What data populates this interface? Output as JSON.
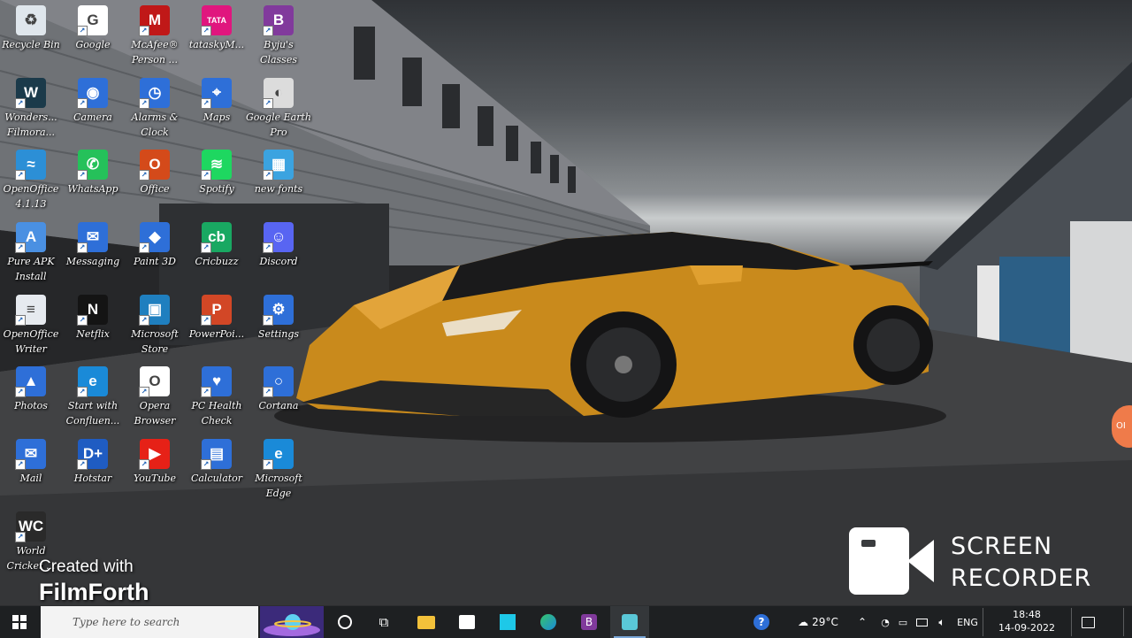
{
  "desktop": {
    "icons": [
      {
        "label": "Recycle Bin",
        "icon": "recycle-bin-icon",
        "color": "#dfe6ec",
        "glyph": "♻"
      },
      {
        "label": "Google",
        "icon": "google-icon",
        "color": "#ffffff",
        "glyph": "G"
      },
      {
        "label": "McAfee® Person ...",
        "icon": "mcafee-icon",
        "color": "#c01818",
        "glyph": "M"
      },
      {
        "label": "tataskyM...",
        "icon": "tata-play-icon",
        "color": "#e0167e",
        "glyph": "TATA"
      },
      {
        "label": "Byju's Classes",
        "icon": "byjus-icon",
        "color": "#813a9c",
        "glyph": "B"
      },
      {
        "label": "Wonders... Filmora...",
        "icon": "filmora-icon",
        "color": "#1b3a4a",
        "glyph": "W"
      },
      {
        "label": "Camera",
        "icon": "camera-icon",
        "color": "#2e6fd8",
        "glyph": "◉"
      },
      {
        "label": "Alarms & Clock",
        "icon": "clock-icon",
        "color": "#2e6fd8",
        "glyph": "◷"
      },
      {
        "label": "Maps",
        "icon": "maps-icon",
        "color": "#2e6fd8",
        "glyph": "⌖"
      },
      {
        "label": "Google Earth Pro",
        "icon": "google-earth-icon",
        "color": "#dcdcdc",
        "glyph": "◐"
      },
      {
        "label": "OpenOffice 4.1.13",
        "icon": "openoffice-icon",
        "color": "#2c8fd6",
        "glyph": "≈"
      },
      {
        "label": "WhatsApp",
        "icon": "whatsapp-icon",
        "color": "#25c15a",
        "glyph": "✆"
      },
      {
        "label": "Office",
        "icon": "office-icon",
        "color": "#d44a1a",
        "glyph": "O"
      },
      {
        "label": "Spotify",
        "icon": "spotify-icon",
        "color": "#1ed760",
        "glyph": "≋"
      },
      {
        "label": "new fonts",
        "icon": "folder-zip-icon",
        "color": "#3ba3e0",
        "glyph": "▦"
      },
      {
        "label": "Pure APK Install",
        "icon": "pure-apk-icon",
        "color": "#4a90e2",
        "glyph": "A"
      },
      {
        "label": "Messaging",
        "icon": "messaging-icon",
        "color": "#2e6fd8",
        "glyph": "✉"
      },
      {
        "label": "Paint 3D",
        "icon": "paint-3d-icon",
        "color": "#2e6fd8",
        "glyph": "◆"
      },
      {
        "label": "Cricbuzz",
        "icon": "cricbuzz-icon",
        "color": "#19a862",
        "glyph": "cb"
      },
      {
        "label": "Discord",
        "icon": "discord-icon",
        "color": "#5865f2",
        "glyph": "☺"
      },
      {
        "label": "OpenOffice Writer",
        "icon": "writer-icon",
        "color": "#e6eaef",
        "glyph": "≡"
      },
      {
        "label": "Netflix",
        "icon": "netflix-icon",
        "color": "#141414",
        "glyph": "N"
      },
      {
        "label": "Microsoft Store",
        "icon": "store-icon",
        "color": "#1f7fbf",
        "glyph": "▣"
      },
      {
        "label": "PowerPoi...",
        "icon": "powerpoint-icon",
        "color": "#d24726",
        "glyph": "P"
      },
      {
        "label": "Settings",
        "icon": "settings-icon",
        "color": "#2e6fd8",
        "glyph": "⚙"
      },
      {
        "label": "Photos",
        "icon": "photos-icon",
        "color": "#2e6fd8",
        "glyph": "▲"
      },
      {
        "label": "Start with Confluen...",
        "icon": "edge-icon",
        "color": "#1a8ad8",
        "glyph": "e"
      },
      {
        "label": "Opera Browser",
        "icon": "opera-icon",
        "color": "#ffffff",
        "glyph": "O"
      },
      {
        "label": "PC Health Check",
        "icon": "health-check-icon",
        "color": "#2e6fd8",
        "glyph": "♥"
      },
      {
        "label": "Cortana",
        "icon": "cortana-icon",
        "color": "#2e6fd8",
        "glyph": "○"
      },
      {
        "label": "Mail",
        "icon": "mail-icon",
        "color": "#2e6fd8",
        "glyph": "✉"
      },
      {
        "label": "Hotstar",
        "icon": "hotstar-icon",
        "color": "#1f5cc2",
        "glyph": "D+"
      },
      {
        "label": "YouTube",
        "icon": "youtube-icon",
        "color": "#e62117",
        "glyph": "▶"
      },
      {
        "label": "Calculator",
        "icon": "calculator-icon",
        "color": "#2e6fd8",
        "glyph": "▤"
      },
      {
        "label": "Microsoft Edge",
        "icon": "edge-browser-icon",
        "color": "#1a8ad8",
        "glyph": "e"
      },
      {
        "label": "World Cricket ...",
        "icon": "world-cricket-icon",
        "color": "#2a2a2a",
        "glyph": "WC"
      }
    ]
  },
  "watermark": {
    "line1": "Created with",
    "line2": "FilmForth"
  },
  "recorder": {
    "line1": "SCREEN",
    "line2": "RECORDER"
  },
  "side_bubble": {
    "text": "OI"
  },
  "taskbar": {
    "search_placeholder": "Type here to search",
    "weather_temp": "29°C",
    "language": "ENG",
    "time": "18:48",
    "date": "14-09-2022"
  },
  "colors": {
    "taskbar": "#1e2022",
    "accent": "#7aa7d8"
  }
}
